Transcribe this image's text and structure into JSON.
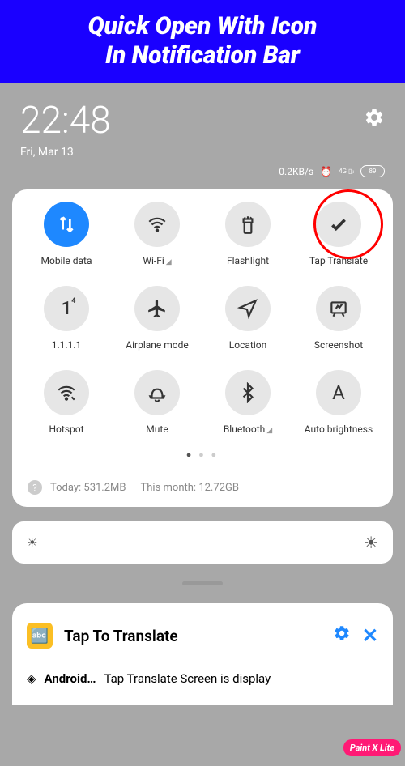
{
  "banner": {
    "line1": "Quick Open With Icon",
    "line2": "In Notification Bar"
  },
  "status": {
    "time": "22:48",
    "date": "Fri, Mar 13",
    "speed": "0.2KB/s",
    "network": "4G",
    "battery": "89"
  },
  "tiles": [
    {
      "label": "Mobile data",
      "icon": "arrows-updown",
      "active": true
    },
    {
      "label": "Wi-Fi",
      "icon": "wifi",
      "triangle": true
    },
    {
      "label": "Flashlight",
      "icon": "flashlight"
    },
    {
      "label": "Tap Translate",
      "icon": "check",
      "highlight": true
    },
    {
      "label": "1.1.1.1",
      "icon": "one"
    },
    {
      "label": "Airplane mode",
      "icon": "airplane"
    },
    {
      "label": "Location",
      "icon": "location"
    },
    {
      "label": "Screenshot",
      "icon": "screenshot"
    },
    {
      "label": "Hotspot",
      "icon": "hotspot"
    },
    {
      "label": "Mute",
      "icon": "bell"
    },
    {
      "label": "Bluetooth",
      "icon": "bluetooth",
      "triangle": true
    },
    {
      "label": "Auto brightness",
      "icon": "letter-a"
    }
  ],
  "usage": {
    "today_label": "Today:",
    "today_value": "531.2MB",
    "month_label": "This month:",
    "month_value": "12.72GB"
  },
  "notification": {
    "title": "Tap To Translate",
    "app": "Android…",
    "text": "Tap Translate Screen is display"
  },
  "watermark": "Paint X Lite"
}
